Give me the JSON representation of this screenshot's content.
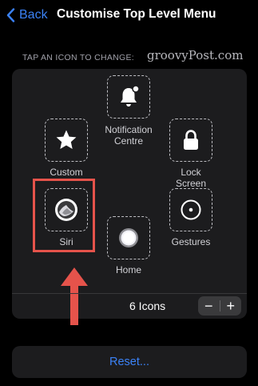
{
  "nav": {
    "back_label": "Back",
    "title": "Customise Top Level Menu"
  },
  "section_header": "TAP AN ICON TO CHANGE:",
  "watermark": "groovyPost.com",
  "slots": {
    "notification": {
      "label_line1": "Notification",
      "label_line2": "Centre",
      "icon": "bell-icon"
    },
    "custom": {
      "label": "Custom",
      "icon": "star-icon"
    },
    "lock": {
      "label_line1": "Lock",
      "label_line2": "Screen",
      "icon": "lock-icon"
    },
    "siri": {
      "label": "Siri",
      "icon": "siri-icon"
    },
    "gestures": {
      "label": "Gestures",
      "icon": "gestures-icon"
    },
    "home": {
      "label": "Home",
      "icon": "home-icon"
    }
  },
  "footer": {
    "icons_count": "6 Icons",
    "decrement": "−",
    "increment": "+"
  },
  "reset_label": "Reset...",
  "colors": {
    "accent": "#3b82f6",
    "highlight": "#e5534b",
    "panel": "#1c1c1e"
  }
}
